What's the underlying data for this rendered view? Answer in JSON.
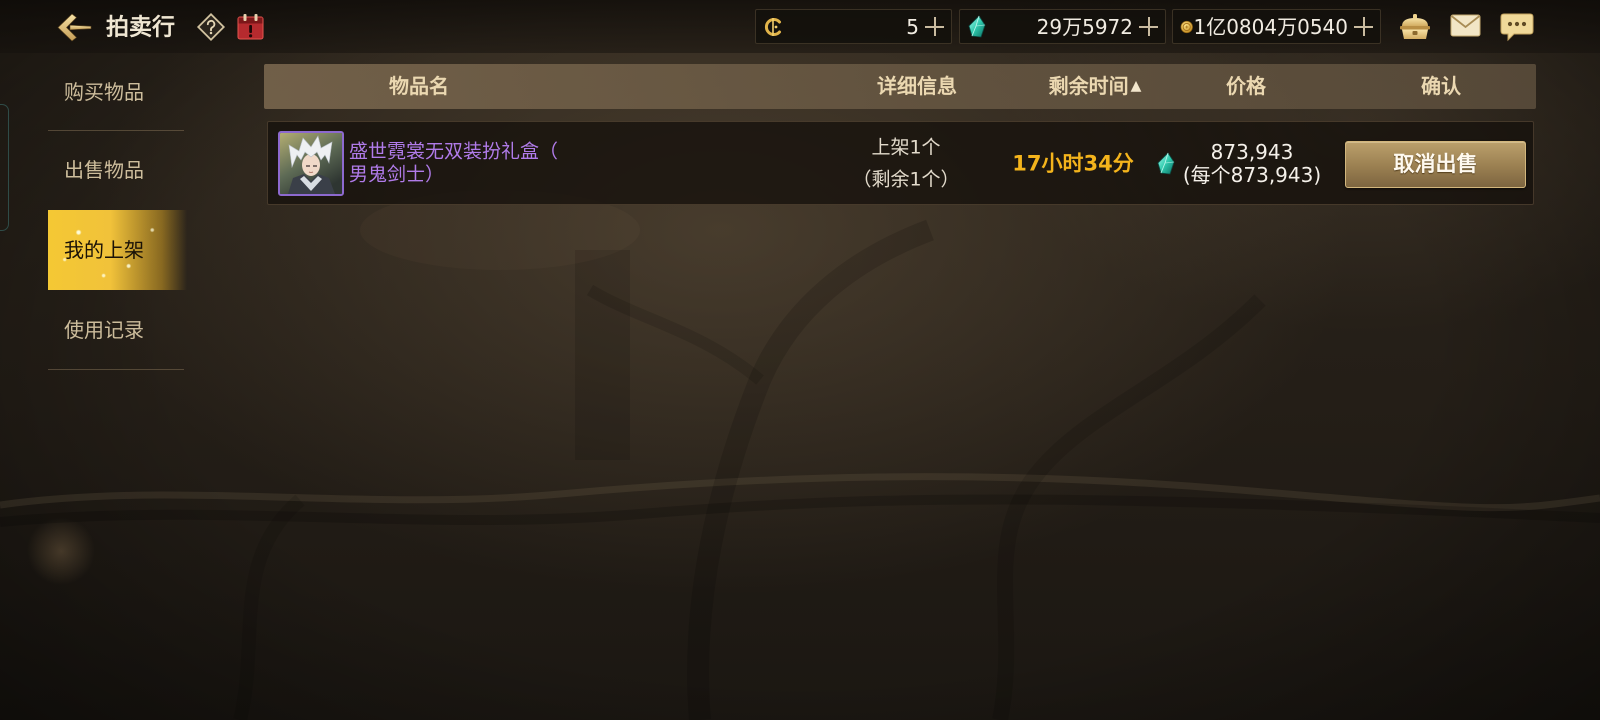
{
  "window": {
    "title": "拍卖行"
  },
  "toolbar": {
    "back_icon": "back-arrow-icon",
    "help_icon": "help-diamond-icon",
    "calendar_icon": "calendar-alert-icon"
  },
  "currencies": [
    {
      "icon": "cera-coin-icon",
      "value": "5",
      "add_icon": "plus-icon"
    },
    {
      "icon": "green-gem-icon",
      "value": "29万5972",
      "add_icon": "plus-icon"
    },
    {
      "icon": "gold-coin-icon",
      "value": "1亿0804万0540",
      "add_icon": "plus-icon"
    }
  ],
  "menu_icons": {
    "storage": "storage-chest-icon",
    "mail": "mail-icon",
    "chat": "chat-bubble-icon"
  },
  "sidebar": {
    "items": [
      {
        "label": "购买物品",
        "selected": false
      },
      {
        "label": "出售物品",
        "selected": false
      },
      {
        "label": "我的上架",
        "selected": true
      },
      {
        "label": "使用记录",
        "selected": false
      }
    ]
  },
  "table": {
    "columns": {
      "name": "物品名",
      "details": "详细信息",
      "time_left": "剩余时间",
      "time_left_sort_indicator": "▲",
      "price": "价格",
      "confirm": "确认"
    },
    "rows": [
      {
        "item_icon": "character-costume-portrait-icon",
        "name_lines": [
          "盛世霓裳无双装扮礼盒（",
          "男鬼剑士）"
        ],
        "details_lines": [
          "上架1个",
          "（剩余1个）"
        ],
        "time_left": "17小时34分",
        "price_icon": "green-gem-icon",
        "price_total": "873,943",
        "price_each": "(每个873,943)",
        "action_label": "取消出售"
      }
    ]
  },
  "colors": {
    "accent_gold": "#f4c834",
    "item_name_purple": "#b07be9",
    "time_left_orange": "#f4b41c",
    "header_text": "#ebd8b1",
    "sidebar_text": "#cdbd9c"
  }
}
